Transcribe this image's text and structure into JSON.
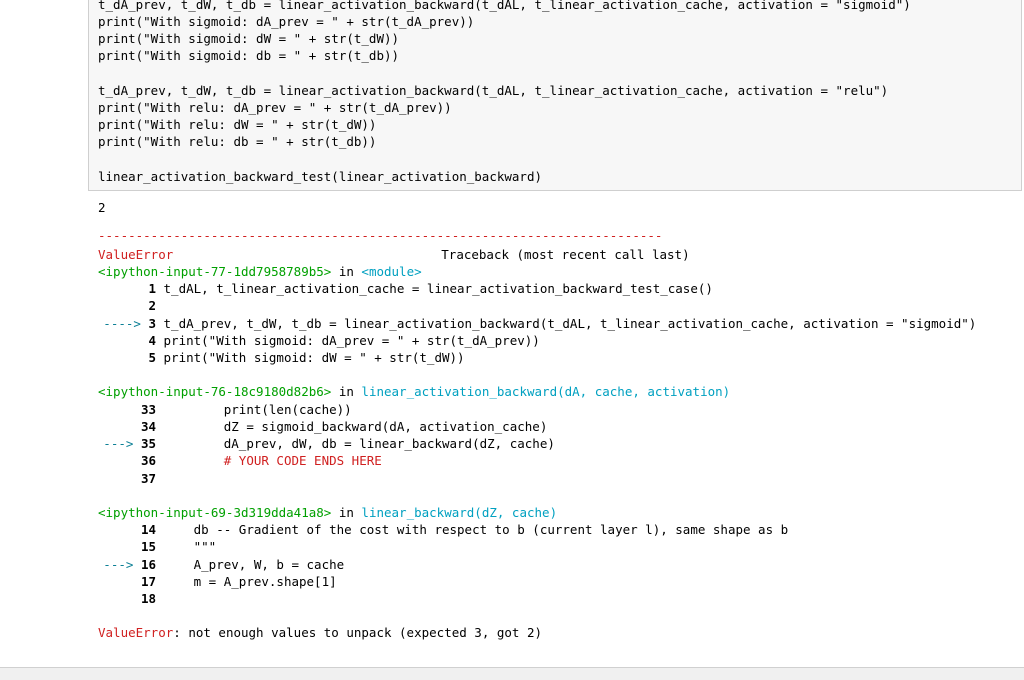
{
  "input_cell": {
    "lines": [
      "t_dA_prev, t_dW, t_db = linear_activation_backward(t_dAL, t_linear_activation_cache, activation = \"sigmoid\")",
      "print(\"With sigmoid: dA_prev = \" + str(t_dA_prev))",
      "print(\"With sigmoid: dW = \" + str(t_dW))",
      "print(\"With sigmoid: db = \" + str(t_db))",
      "",
      "t_dA_prev, t_dW, t_db = linear_activation_backward(t_dAL, t_linear_activation_cache, activation = \"relu\")",
      "print(\"With relu: dA_prev = \" + str(t_dA_prev))",
      "print(\"With relu: dW = \" + str(t_dW))",
      "print(\"With relu: db = \" + str(t_db))",
      "",
      "linear_activation_backward_test(linear_activation_backward)"
    ]
  },
  "output": {
    "stdout": "2",
    "separator": "---------------------------------------------------------------------------",
    "error_type": "ValueError",
    "traceback_header": "Traceback (most recent call last)",
    "frames": [
      {
        "location": "<ipython-input-77-1dd7958789b5>",
        "in_word": "in",
        "context": "<module>",
        "lines": [
          {
            "arrow": "",
            "num": "1",
            "code": "t_dAL, t_linear_activation_cache = linear_activation_backward_test_case()"
          },
          {
            "arrow": "",
            "num": "2",
            "code": ""
          },
          {
            "arrow": "---->",
            "num": "3",
            "code": "t_dA_prev, t_dW, t_db = linear_activation_backward(t_dAL, t_linear_activation_cache, activation = \"sigmoid\")"
          },
          {
            "arrow": "",
            "num": "4",
            "code": "print(\"With sigmoid: dA_prev = \" + str(t_dA_prev))"
          },
          {
            "arrow": "",
            "num": "5",
            "code": "print(\"With sigmoid: dW = \" + str(t_dW))"
          }
        ]
      },
      {
        "location": "<ipython-input-76-18c9180d82b6>",
        "in_word": "in",
        "context": "linear_activation_backward(dA, cache, activation)",
        "lines": [
          {
            "arrow": "",
            "num": "33",
            "code": "        print(len(cache))"
          },
          {
            "arrow": "",
            "num": "34",
            "code": "        dZ = sigmoid_backward(dA, activation_cache)"
          },
          {
            "arrow": "--->",
            "num": "35",
            "code": "        dA_prev, dW, db = linear_backward(dZ, cache)"
          },
          {
            "arrow": "",
            "num": "36",
            "code": "        # YOUR CODE ENDS HERE"
          },
          {
            "arrow": "",
            "num": "37",
            "code": ""
          }
        ]
      },
      {
        "location": "<ipython-input-69-3d319dda41a8>",
        "in_word": "in",
        "context": "linear_backward(dZ, cache)",
        "lines": [
          {
            "arrow": "",
            "num": "14",
            "code": "    db -- Gradient of the cost with respect to b (current layer l), same shape as b"
          },
          {
            "arrow": "",
            "num": "15",
            "code": "    \"\"\""
          },
          {
            "arrow": "--->",
            "num": "16",
            "code": "    A_prev, W, b = cache"
          },
          {
            "arrow": "",
            "num": "17",
            "code": "    m = A_prev.shape[1]"
          },
          {
            "arrow": "",
            "num": "18",
            "code": ""
          }
        ]
      }
    ],
    "final_error": "ValueError",
    "final_message": ": not enough values to unpack (expected 3, got 2)"
  }
}
